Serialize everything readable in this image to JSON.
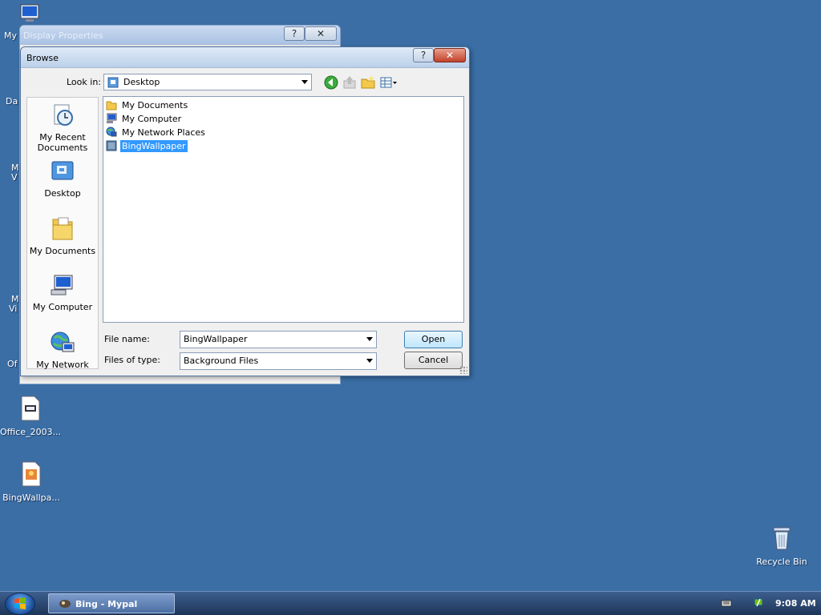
{
  "desktop": {
    "icons": [
      {
        "label": "My",
        "name": "my-computer"
      },
      {
        "label": "Office_2003...",
        "name": "office-2003"
      },
      {
        "label": "BingWallpa...",
        "name": "bingwallpaper"
      },
      {
        "label": "Recycle Bin",
        "name": "recycle-bin"
      }
    ],
    "clipped_labels": [
      "Da",
      "M",
      "V",
      "M",
      "Vi",
      "Of"
    ]
  },
  "background_window": {
    "title": "Display Properties",
    "help_label": "?",
    "close_label": "✕"
  },
  "dialog": {
    "title": "Browse",
    "help_label": "?",
    "close_label": "✕",
    "look_in_label": "Look in:",
    "look_in_value": "Desktop",
    "toolbar_icons": [
      "back-icon",
      "up-folder-icon",
      "new-folder-icon",
      "views-menu-icon"
    ],
    "places": [
      {
        "label": "My Recent Documents",
        "icon": "recent-documents-icon"
      },
      {
        "label": "Desktop",
        "icon": "desktop-icon"
      },
      {
        "label": "My Documents",
        "icon": "my-documents-icon"
      },
      {
        "label": "My Computer",
        "icon": "my-computer-icon"
      },
      {
        "label": "My Network",
        "icon": "my-network-icon"
      }
    ],
    "files": [
      {
        "label": "My Documents",
        "icon": "folder-icon",
        "selected": false
      },
      {
        "label": "My Computer",
        "icon": "computer-icon",
        "selected": false
      },
      {
        "label": "My Network Places",
        "icon": "network-icon",
        "selected": false
      },
      {
        "label": "BingWallpaper",
        "icon": "image-file-icon",
        "selected": true
      }
    ],
    "file_name_label": "File name:",
    "file_name_value": "BingWallpaper",
    "files_of_type_label": "Files of type:",
    "files_of_type_value": "Background Files",
    "open_label": "Open",
    "cancel_label": "Cancel"
  },
  "taskbar": {
    "task_label": "Bing - Mypal",
    "clock": "9:08 AM",
    "colors": {
      "desktop": "#3a6ea5",
      "selection": "#3399ff"
    }
  }
}
